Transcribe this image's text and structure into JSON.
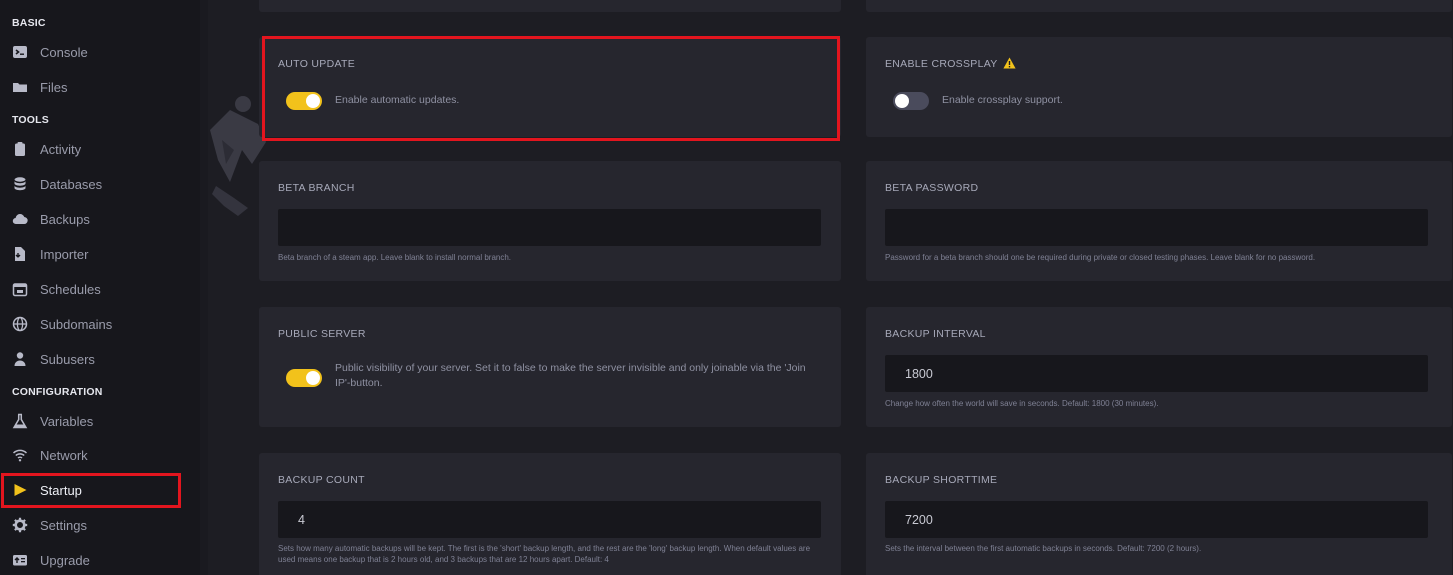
{
  "sidebar": {
    "sections": {
      "basic": "BASIC",
      "tools": "TOOLS",
      "configuration": "CONFIGURATION"
    },
    "items": [
      {
        "label": "Console",
        "icon": "terminal-icon"
      },
      {
        "label": "Files",
        "icon": "folder-icon"
      },
      {
        "label": "Activity",
        "icon": "clipboard-icon"
      },
      {
        "label": "Databases",
        "icon": "database-icon"
      },
      {
        "label": "Backups",
        "icon": "cloud-icon"
      },
      {
        "label": "Importer",
        "icon": "file-import-icon"
      },
      {
        "label": "Schedules",
        "icon": "calendar-icon"
      },
      {
        "label": "Subdomains",
        "icon": "globe-icon"
      },
      {
        "label": "Subusers",
        "icon": "user-icon"
      },
      {
        "label": "Variables",
        "icon": "flask-icon"
      },
      {
        "label": "Network",
        "icon": "wifi-icon"
      },
      {
        "label": "Startup",
        "icon": "play-icon",
        "active": true
      },
      {
        "label": "Settings",
        "icon": "gear-icon"
      },
      {
        "label": "Upgrade",
        "icon": "upgrade-icon"
      }
    ]
  },
  "cards": {
    "auto_update": {
      "title": "AUTO UPDATE",
      "toggle_label": "Enable automatic updates.",
      "enabled": true
    },
    "enable_crossplay": {
      "title": "ENABLE CROSSPLAY",
      "toggle_label": "Enable crossplay support.",
      "enabled": false
    },
    "beta_branch": {
      "title": "BETA BRANCH",
      "value": "",
      "hint": "Beta branch of a steam app. Leave blank to install normal branch."
    },
    "beta_password": {
      "title": "BETA PASSWORD",
      "value": "",
      "hint": "Password for a beta branch should one be required during private or closed testing phases. Leave blank for no password."
    },
    "public_server": {
      "title": "PUBLIC SERVER",
      "toggle_label": "Public visibility of your server. Set it to false to make the server invisible and only joinable via the 'Join IP'-button.",
      "enabled": true
    },
    "backup_interval": {
      "title": "BACKUP INTERVAL",
      "value": "1800",
      "hint": "Change how often the world will save in seconds. Default: 1800 (30 minutes)."
    },
    "backup_count": {
      "title": "BACKUP COUNT",
      "value": "4",
      "hint": "Sets how many automatic backups will be kept. The first is the 'short' backup length, and the rest are the 'long' backup length. When default values are used means one backup that is 2 hours old, and 3 backups that are 12 hours apart. Default: 4"
    },
    "backup_shorttime": {
      "title": "BACKUP SHORTTIME",
      "value": "7200",
      "hint": "Sets the interval between the first automatic backups in seconds. Default: 7200 (2 hours)."
    }
  },
  "colors": {
    "accent": "#f2c21b",
    "highlight": "#e3151e",
    "card": "#26262e",
    "sidebar": "#17171c"
  }
}
